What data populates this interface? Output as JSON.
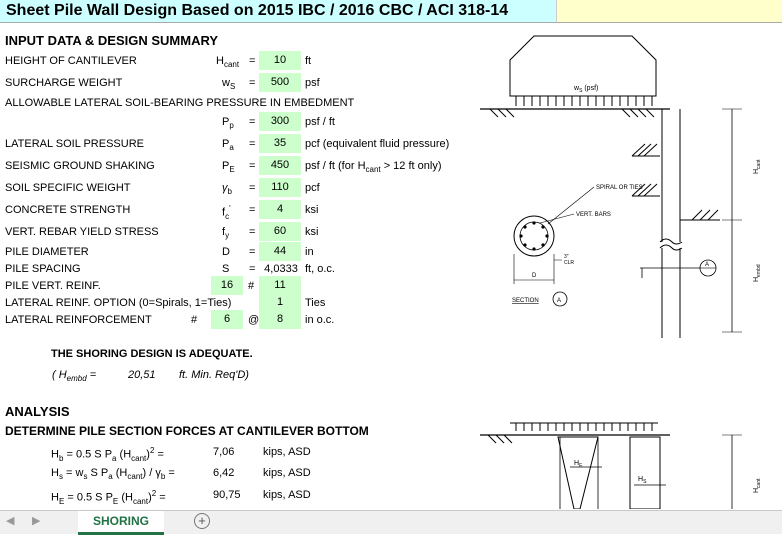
{
  "title": "Sheet Pile Wall Design Based on 2015 IBC / 2016 CBC / ACI 318-14",
  "input_header": "INPUT DATA & DESIGN SUMMARY",
  "rows": {
    "height": {
      "label": "HEIGHT OF CANTILEVER",
      "sym": "H",
      "sub": "cant",
      "eq": "=",
      "value": "10",
      "unit": "ft"
    },
    "surcharge": {
      "label": "SURCHARGE WEIGHT",
      "sym": "w",
      "sub": "S",
      "eq": "=",
      "value": "500",
      "unit": "psf"
    },
    "allowable_label": "ALLOWABLE LATERAL SOIL-BEARING PRESSURE IN EMBEDMENT",
    "pp": {
      "sym": "P",
      "sub": "p",
      "eq": "=",
      "value": "300",
      "unit": "psf / ft"
    },
    "lateral": {
      "label": "LATERAL SOIL PRESSURE",
      "sym": "P",
      "sub": "a",
      "eq": "=",
      "value": "35",
      "unit": "pcf (equivalent fluid pressure)"
    },
    "seismic": {
      "label": "SEISMIC GROUND SHAKING",
      "sym": "P",
      "sub": "E",
      "eq": "=",
      "value": "450",
      "unit_a": "psf / ft  (for H",
      "unit_sub": "cant",
      "unit_b": " > 12 ft only)"
    },
    "weight": {
      "label": "SOIL SPECIFIC WEIGHT",
      "sym": "γ",
      "sub": "b",
      "eq": "=",
      "value": "110",
      "unit": "pcf"
    },
    "concrete": {
      "label": "CONCRETE STRENGTH",
      "sym": "f",
      "sub": "c",
      "sup": "'",
      "eq": "=",
      "value": "4",
      "unit": "ksi"
    },
    "rebar": {
      "label": "VERT. REBAR YIELD STRESS",
      "sym": "f",
      "sub": "y",
      "eq": "=",
      "value": "60",
      "unit": "ksi"
    },
    "diameter": {
      "label": "PILE DIAMETER",
      "sym": "D",
      "eq": "=",
      "value": "44",
      "unit": "in"
    },
    "spacing": {
      "label": "PILE SPACING",
      "sym": "S",
      "eq": "=",
      "value": "4,0333",
      "unit": "ft, o.c."
    },
    "vert_reinf": {
      "label": "PILE VERT. REINF.",
      "count": "16",
      "hash": "#",
      "size": "11"
    },
    "lat_option": {
      "label": "LATERAL REINF. OPTION (0=Spirals, 1=Ties)",
      "value": "1",
      "unit": "Ties"
    },
    "lat_reinf": {
      "label": "LATERAL REINFORCEMENT",
      "hash": "#",
      "size": "6",
      "at": "@",
      "spacing": "8",
      "unit": "in o.c."
    }
  },
  "adequate": "THE SHORING DESIGN IS ADEQUATE.",
  "hembd": {
    "open": "( H",
    "sub": "embd",
    "eq": " =",
    "value": "20,51",
    "note": "ft. Min. Req'D)"
  },
  "analysis_header": "ANALYSIS",
  "forces_header": "DETERMINE PILE SECTION FORCES AT CANTILEVER BOTTOM",
  "forces": [
    {
      "lhs": "H",
      "lhs_sub": "b",
      "rhs": "= 0.5 S P",
      "rhs_sub": "a",
      "rhs2": " (H",
      "rhs2_sub": "cant",
      "rhs3": ")",
      "sup": "2",
      "rhs4": " =",
      "value": "7,06",
      "unit": "kips, ASD"
    },
    {
      "lhs": "H",
      "lhs_sub": "s",
      "rhs": "= w",
      "rhs_sub": "s",
      "rhs2": " S P",
      "rhs2_sub": "a",
      "rhs3": " (H",
      "rhs3_sub": "cant",
      "rhs4": ") / γ",
      "rhs4_sub": "b",
      "rhs5": " =",
      "value": "6,42",
      "unit": "kips, ASD"
    },
    {
      "lhs": "H",
      "lhs_sub": "E",
      "rhs": "= 0.5 S P",
      "rhs_sub": "E",
      "rhs2": " (H",
      "rhs2_sub": "cant",
      "rhs3": ")",
      "sup": "2",
      "rhs4": " =",
      "value": "90,75",
      "unit": "kips, ASD"
    }
  ],
  "diagram": {
    "ws_label": "w",
    "ws_sub": "S",
    "ws_unit": " (psf)",
    "spiral": "SPIRAL OR TIES",
    "vert_bars": "VERT. BARS",
    "clr": "3\"",
    "clr2": "CLR",
    "d": "D",
    "section": "SECTION",
    "a": "A",
    "hcant": "H",
    "hcant_sub": "cant",
    "hembd": "H",
    "hembd_sub": "embd",
    "he": "H",
    "he_sub": "E",
    "hs": "H",
    "hs_sub": "S"
  },
  "tabs": {
    "active": "SHORING",
    "add": "+",
    "prev": "◀",
    "next": "▶"
  },
  "colors": {
    "title_bg": "#ccffff",
    "input_bg": "#ccffcc",
    "accent": "#217346"
  }
}
